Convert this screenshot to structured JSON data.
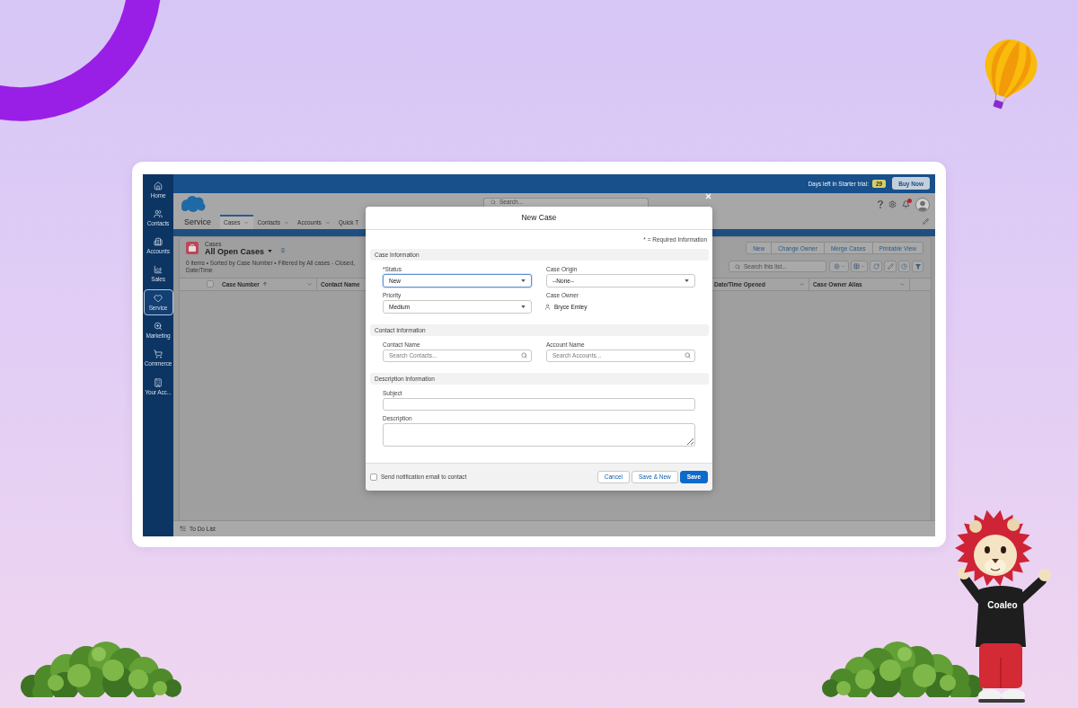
{
  "decor": {
    "mascot_text": "Coaleo"
  },
  "app": {
    "nav": [
      {
        "label": "Home",
        "selected": false
      },
      {
        "label": "Contacts",
        "selected": false
      },
      {
        "label": "Accounts",
        "selected": false
      },
      {
        "label": "Sales",
        "selected": false
      },
      {
        "label": "Service",
        "selected": true
      },
      {
        "label": "Marketing",
        "selected": false
      },
      {
        "label": "Commerce",
        "selected": false
      },
      {
        "label": "Your Acc...",
        "selected": false
      }
    ],
    "trial": {
      "text": "Days left in Starter trial:",
      "days": "29",
      "button": "Buy Now"
    },
    "header": {
      "app_name": "Service",
      "search_placeholder": "Search...",
      "notifications_unread": true,
      "tabs": [
        {
          "label": "Cases",
          "selected": true,
          "menu": true
        },
        {
          "label": "Contacts",
          "selected": false,
          "menu": true
        },
        {
          "label": "Accounts",
          "selected": false,
          "menu": true
        },
        {
          "label": "Quick T",
          "selected": false,
          "menu": false
        }
      ]
    },
    "list": {
      "object_label": "Cases",
      "title": "All Open Cases",
      "summary": "0 items • Sorted by Case Number • Filtered by All cases - Closed, Date/Time",
      "actions": [
        "New",
        "Change Owner",
        "Merge Cases",
        "Printable View"
      ],
      "search_placeholder": "Search this list...",
      "select_all_checked": false,
      "columns_left": [
        {
          "label": "Case Number",
          "sorted": true,
          "menu": true
        },
        {
          "label": "Contact Name",
          "sorted": false,
          "menu": false
        }
      ],
      "columns_right": [
        {
          "label": "Date/Time Opened",
          "sorted": false,
          "menu": true
        },
        {
          "label": "Case Owner Alias",
          "sorted": false,
          "menu": true
        }
      ]
    },
    "utility_bar": {
      "label": "To Do List"
    }
  },
  "modal": {
    "title": "New Case",
    "required_note": "* = Required Information",
    "sections": [
      {
        "title": "Case Information",
        "fields": [
          {
            "kind": "select",
            "label": "*Status",
            "value": "New",
            "focused": true
          },
          {
            "kind": "select",
            "label": "Case Origin",
            "value": "--None--",
            "focused": false
          },
          {
            "kind": "select",
            "label": "Priority",
            "value": "Medium",
            "focused": false
          },
          {
            "kind": "owner",
            "label": "Case Owner",
            "value": "Bryce Emley"
          }
        ]
      },
      {
        "title": "Contact Information",
        "fields": [
          {
            "kind": "lookup",
            "label": "Contact Name",
            "placeholder": "Search Contacts..."
          },
          {
            "kind": "lookup",
            "label": "Account Name",
            "placeholder": "Search Accounts..."
          }
        ]
      },
      {
        "title": "Description Information",
        "fields": [
          {
            "kind": "text",
            "label": "Subject"
          },
          {
            "kind": "textarea",
            "label": "Description"
          }
        ]
      }
    ],
    "notify": {
      "label": "Send notification email to contact",
      "checked": false
    },
    "buttons": [
      {
        "label": "Cancel",
        "kind": "neutral"
      },
      {
        "label": "Save & New",
        "kind": "neutral"
      },
      {
        "label": "Save",
        "kind": "brand"
      }
    ]
  }
}
